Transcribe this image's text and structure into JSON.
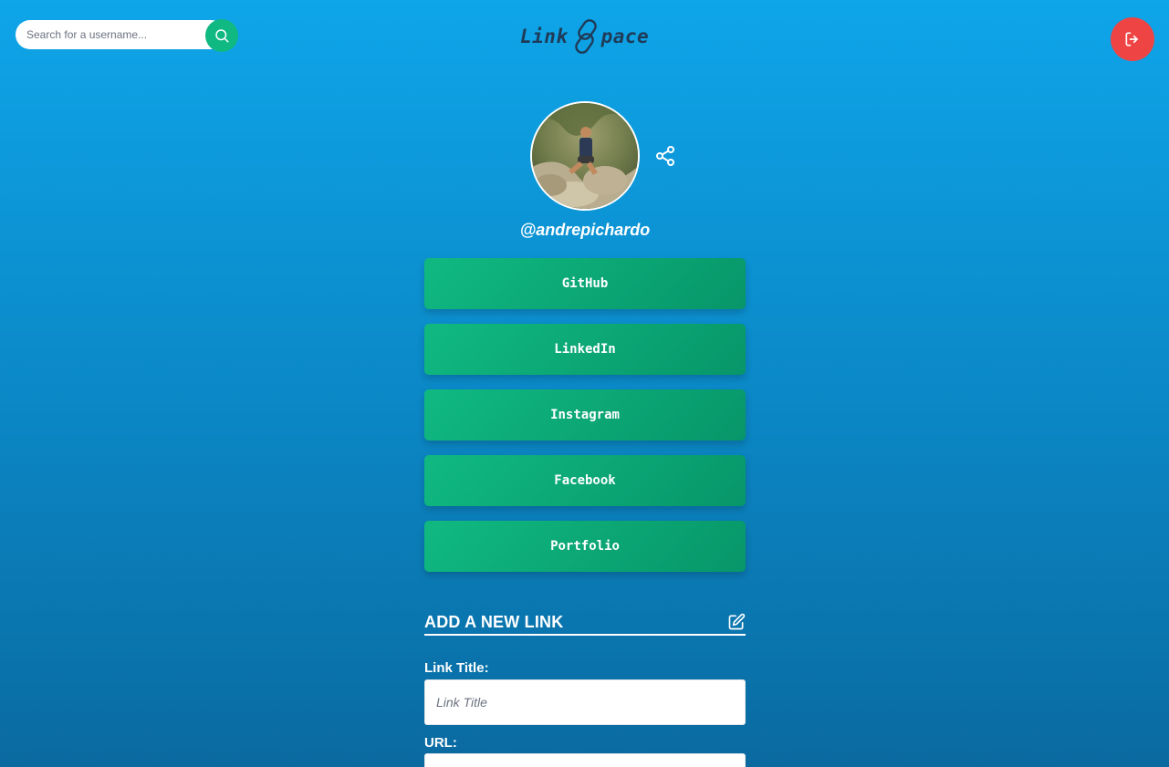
{
  "search": {
    "placeholder": "Search for a username...",
    "button_icon": "search-icon"
  },
  "logo": {
    "part1": "Link",
    "part2": "pace",
    "icon": "chain-link-s-icon",
    "color": "#1f3b57"
  },
  "header": {
    "logout_icon": "logout-icon",
    "logout_color": "#ef4444"
  },
  "profile": {
    "username": "@andrepichardo",
    "share_icon": "share-icon"
  },
  "links": [
    {
      "label": "GitHub"
    },
    {
      "label": "LinkedIn"
    },
    {
      "label": "Instagram"
    },
    {
      "label": "Facebook"
    },
    {
      "label": "Portfolio"
    }
  ],
  "add_link": {
    "heading": "ADD A NEW LINK",
    "edit_icon": "edit-icon",
    "title_label": "Link Title:",
    "title_placeholder": "Link Title",
    "url_label": "URL:",
    "url_placeholder": ""
  },
  "colors": {
    "accent": "#10b981",
    "background_top": "#0ea5e9",
    "background_bottom": "#0a6aa0",
    "danger": "#ef4444"
  }
}
